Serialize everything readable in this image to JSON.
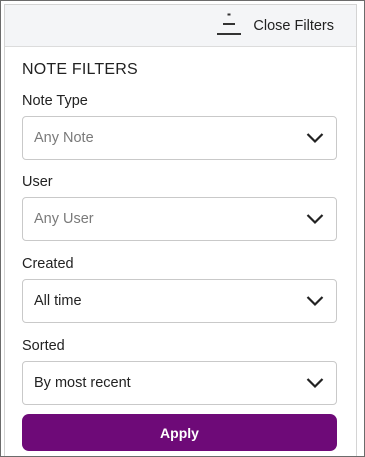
{
  "header": {
    "close_label": "Close Filters",
    "close_icon": "filter-lines-icon"
  },
  "panel": {
    "title": "NOTE FILTERS"
  },
  "filters": {
    "note_type": {
      "label": "Note Type",
      "value": "Any Note",
      "is_placeholder": true
    },
    "user": {
      "label": "User",
      "value": "Any User",
      "is_placeholder": true
    },
    "created": {
      "label": "Created",
      "value": "All time",
      "is_placeholder": false
    },
    "sorted": {
      "label": "Sorted",
      "value": "By most recent",
      "is_placeholder": false
    }
  },
  "actions": {
    "apply_label": "Apply"
  },
  "colors": {
    "accent": "#6e0a78",
    "header_bg": "#f4f5f7",
    "placeholder_text": "#7a7a7a"
  }
}
